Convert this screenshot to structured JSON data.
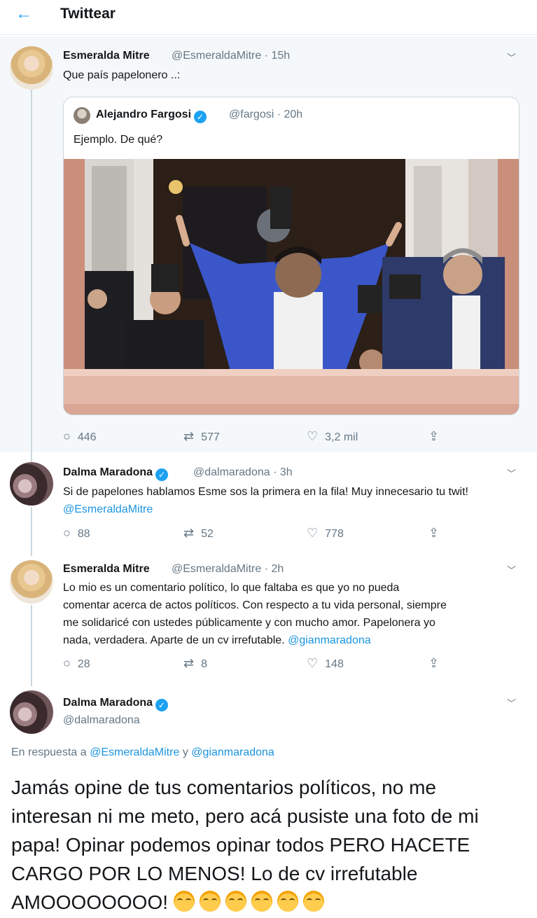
{
  "header": {
    "back_icon": "arrow-left-icon",
    "title": "Twittear"
  },
  "parent_tweet": {
    "name": "Esmeralda Mitre",
    "handle": "@EsmeraldaMitre · 15h",
    "text": "Que país papelonero ..:",
    "quote": {
      "name": "Alejandro Fargosi",
      "verified": true,
      "handle": "@fargosi · 20h",
      "text": "Ejemplo. De qué?"
    },
    "replies": "446",
    "retweets": "577",
    "likes": "3,2 mil"
  },
  "reply_1": {
    "name": "Dalma Maradona",
    "verified": true,
    "handle": "@dalmaradona · 3h",
    "text": "Si de papelones hablamos Esme sos la primera en la fila! Muy innecesario tu twit!",
    "mention": "@EsmeraldaMitre",
    "replies": "88",
    "retweets": "52",
    "likes": "778"
  },
  "reply_2": {
    "name": "Esmeralda Mitre",
    "handle": "@EsmeraldaMitre · 2h",
    "line1": "Lo mio es un comentario político, lo que faltaba es que yo no pueda",
    "line2": "comentar acerca de actos políticos. Con respecto a tu vida personal, siempre",
    "line3": "me solidaricé con ustedes públicamente y con mucho amor. Papelonera yo",
    "line4": "nada, verdadera. Aparte de un cv irrefutable.",
    "mention": "@gianmaradona",
    "replies": "28",
    "retweets": "8",
    "likes": "148"
  },
  "main_tweet": {
    "name": "Dalma Maradona",
    "verified": true,
    "handle": "@dalmaradona",
    "reply_prefix": "En respuesta a",
    "reply_user_1": "@EsmeraldaMitre",
    "reply_and": "y",
    "reply_user_2": "@gianmaradona",
    "line1": "Jamás opine de tus comentarios políticos, no me",
    "line2": "interesan ni me meto, pero acá pusiste una foto de mi",
    "line3": "papa! Opinar podemos opinar todos PERO HACETE",
    "line4": "CARGO POR LO MENOS! Lo de cv irrefutable",
    "line5": "AMOOOOOOOO!",
    "emoji_name": "face-with-tears-of-joy-icon"
  },
  "colors": {
    "accent": "#1da1f2",
    "link": "#1b95e0",
    "muted": "#657786",
    "highlight_bg": "#f5f8fa"
  }
}
